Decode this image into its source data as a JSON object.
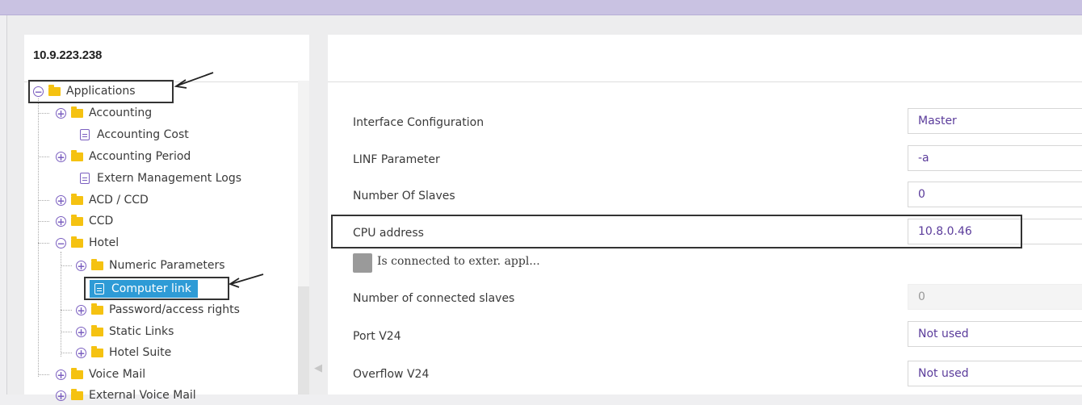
{
  "node": {
    "ip": "10.9.223.238"
  },
  "tree": {
    "applications": "Applications",
    "accounting": "Accounting",
    "accounting_cost": "Accounting Cost",
    "accounting_period": "Accounting Period",
    "extern_logs": "Extern Management Logs",
    "acd_ccd": "ACD / CCD",
    "ccd": "CCD",
    "hotel": "Hotel",
    "numeric_params": "Numeric Parameters",
    "computer_link": "Computer link",
    "password_rights": "Password/access rights",
    "static_links": "Static Links",
    "hotel_suite": "Hotel Suite",
    "voice_mail": "Voice Mail",
    "external_voice_mail": "External Voice Mail"
  },
  "form": {
    "interface_configuration": {
      "label": "Interface Configuration",
      "value": "Master"
    },
    "linf_parameter": {
      "label": "LINF Parameter",
      "value": "-a"
    },
    "number_of_slaves": {
      "label": "Number Of Slaves",
      "value": "0"
    },
    "cpu_address": {
      "label": "CPU address",
      "value": "10.8.0.46"
    },
    "connected_to_external": {
      "label": "Is connected to exter. appl..."
    },
    "connected_slaves": {
      "label": "Number of connected slaves",
      "value": "0"
    },
    "port_v24": {
      "label": "Port V24",
      "value": "Not used"
    },
    "overflow_v24": {
      "label": "Overflow V24",
      "value": "Not used"
    }
  },
  "colors": {
    "accent": "#7b5fc0",
    "selection": "#2e9bd6",
    "folder": "#f5c211",
    "topbar": "#c9c2e2"
  }
}
